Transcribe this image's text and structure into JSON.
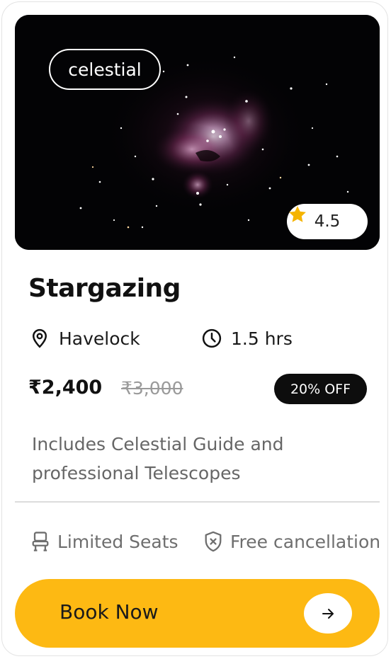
{
  "hero": {
    "category_tag": "celestial",
    "rating": "4.5",
    "image_subject": "Orion nebula star field"
  },
  "activity": {
    "title": "Stargazing",
    "location": "Havelock",
    "duration": "1.5 hrs"
  },
  "pricing": {
    "price": "₹2,400",
    "original_price": "₹3,000",
    "discount": "20% OFF"
  },
  "description": "Includes Celestial Guide and professional Telescopes",
  "features": {
    "seats": "Limited Seats",
    "cancellation": "Free cancellation"
  },
  "cta": {
    "label": "Book Now"
  },
  "colors": {
    "accent": "#fdb913",
    "star": "#f5b400",
    "badge_bg": "#0d0d0d"
  },
  "icons": {
    "location": "map-pin-icon",
    "duration": "clock-icon",
    "seats": "seat-icon",
    "cancellation": "shield-x-icon",
    "rating": "star-icon",
    "cta": "arrow-right-icon"
  }
}
